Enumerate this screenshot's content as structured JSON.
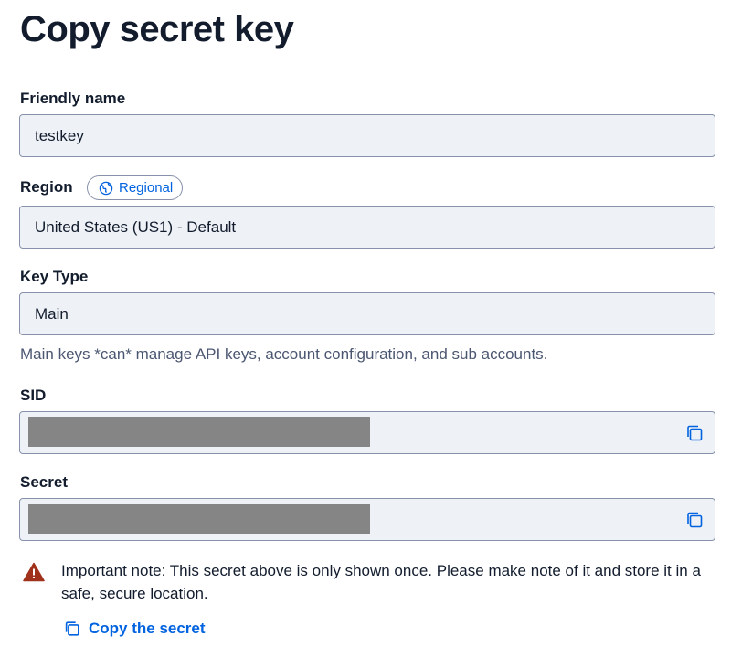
{
  "page": {
    "title": "Copy secret key"
  },
  "friendly_name": {
    "label": "Friendly name",
    "value": "testkey"
  },
  "region": {
    "label": "Region",
    "badge": "Regional",
    "value": "United States (US1) - Default"
  },
  "key_type": {
    "label": "Key Type",
    "value": "Main",
    "help": "Main keys *can* manage API keys, account configuration, and sub accounts."
  },
  "sid": {
    "label": "SID",
    "copy_icon": "copy-icon"
  },
  "secret": {
    "label": "Secret",
    "copy_icon": "copy-icon"
  },
  "note": {
    "icon": "warning-icon",
    "text": "Important note: This secret above is only shown once. Please make note of it and store it in a safe, secure location."
  },
  "copy_link": {
    "label": "Copy the secret",
    "icon": "copy-icon"
  },
  "colors": {
    "link": "#0263e0",
    "warning": "#a0311a",
    "field_bg": "#eef1f6",
    "border": "#8891aa"
  }
}
